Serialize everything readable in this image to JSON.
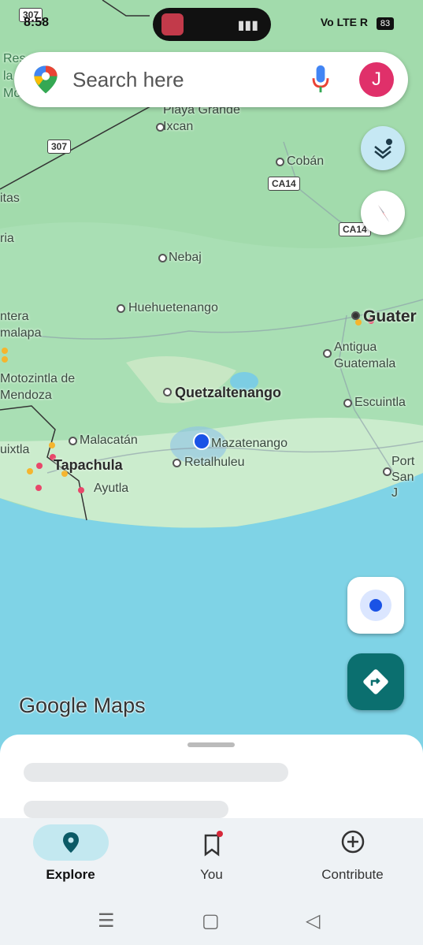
{
  "status_bar": {
    "time": "8:58",
    "indicators": "Vo LTE R",
    "battery": "83"
  },
  "search": {
    "placeholder": "Search here",
    "avatar_letter": "J"
  },
  "map": {
    "places": {
      "playa_grande": "Playa Grande",
      "ixcan": "Ixcan",
      "coban": "Cobán",
      "nebaj": "Nebaj",
      "huehuetenango": "Huehuetenango",
      "guatemala_city": "Guater",
      "antigua": "Antigua Guatemala",
      "quetzaltenango": "Quetzaltenango",
      "escuintla": "Escuintla",
      "malacatan": "Malacatán",
      "mazatenango": "Mazatenango",
      "retalhuleu": "Retalhuleu",
      "tapachula": "Tapachula",
      "ayutla": "Ayutla",
      "port_san_jose": "Port San J",
      "motozintla": "Motozintla de Mendoza",
      "uixtla": "uixtla",
      "ntera": "ntera",
      "malapa": "malapa",
      "itas": "itas",
      "ria": "ria",
      "res": "Res la Mon"
    },
    "shields": {
      "r307a": "307",
      "r307b": "307",
      "ca14a": "CA14",
      "ca14b": "CA14"
    },
    "attribution": "Google Maps"
  },
  "nav": {
    "tabs": [
      {
        "label": "Explore",
        "icon": "location-pin-icon"
      },
      {
        "label": "You",
        "icon": "bookmark-icon"
      },
      {
        "label": "Contribute",
        "icon": "add-circle-icon"
      }
    ]
  }
}
